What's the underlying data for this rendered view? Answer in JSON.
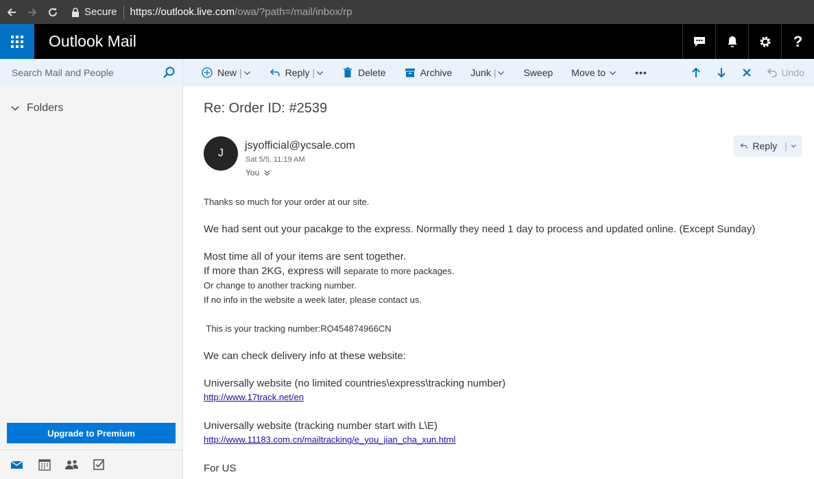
{
  "browser": {
    "secure_label": "Secure",
    "url_host": "https://outlook.live.com",
    "url_path": "/owa/?path=/mail/inbox/rp"
  },
  "app": {
    "title": "Outlook Mail",
    "header_icons": [
      "feedback-icon",
      "bell-icon",
      "gear-icon",
      "help-icon"
    ],
    "help_label": "?"
  },
  "sidebar": {
    "search_placeholder": "Search Mail and People",
    "folders_label": "Folders",
    "upgrade_label": "Upgrade to Premium",
    "bottom_nav": [
      "mail-icon",
      "calendar-icon",
      "people-icon",
      "tasks-icon"
    ]
  },
  "toolbar": {
    "new_label": "New",
    "reply_label": "Reply",
    "delete_label": "Delete",
    "archive_label": "Archive",
    "junk_label": "Junk",
    "sweep_label": "Sweep",
    "move_label": "Move to",
    "more_label": "•••",
    "undo_label": "Undo"
  },
  "message": {
    "subject": "Re: Order ID: #2539",
    "avatar_initial": "J",
    "sender": "jsyofficial@ycsale.com",
    "sent_time": "Sat 5/5, 11:19 AM",
    "to": "You",
    "reply_label": "Reply",
    "body": {
      "thanks": "Thanks so much for your order at our site.",
      "sent_out": "We had sent out your pacakge to the express. Normally they need 1 day to process and updated online. (Except Sunday)",
      "line1": "Most time all of your items are sent together.",
      "line2_a": "If more than 2KG, express will ",
      "line2_b": "separate to more packages.",
      "line3": "Or change to another tracking number.",
      "line4": "If no info in the website a week later, please contact us.",
      "tracking": " This is your tracking number:RO454874966CN",
      "check": "We can check delivery info at these website:",
      "site1_desc": "Universally website (no limited countries\\express\\tracking number)",
      "site1_url": "http://www.17track.net/en",
      "site2_desc": "Universally website (tracking number start with L\\E)",
      "site2_url": "http://www.11183.com.cn/mailtracking/e_you_jian_cha_xun.html",
      "for_us": "For US"
    }
  },
  "colors": {
    "accent": "#0078d7",
    "waffle_bg": "#0072c6",
    "header_bg": "#000000",
    "command_bar_bg": "#eaf3fb"
  }
}
